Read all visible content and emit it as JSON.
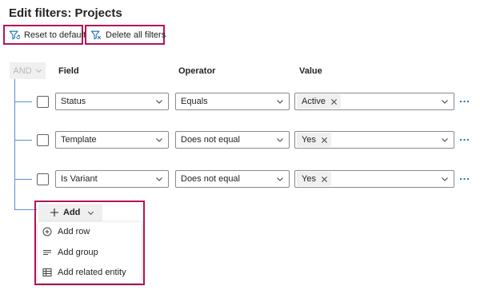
{
  "page": {
    "title": "Edit filters: Projects"
  },
  "toolbar": {
    "reset_label": "Reset to default",
    "delete_label": "Delete all filters"
  },
  "group": {
    "operator": "AND"
  },
  "columns": {
    "field": "Field",
    "operator": "Operator",
    "value": "Value"
  },
  "rows": [
    {
      "field": "Status",
      "operator": "Equals",
      "value": "Active"
    },
    {
      "field": "Template",
      "operator": "Does not equal",
      "value": "Yes"
    },
    {
      "field": "Is Variant",
      "operator": "Does not equal",
      "value": "Yes"
    }
  ],
  "add": {
    "label": "Add",
    "menu": [
      {
        "label": "Add row",
        "icon": "add-circle-icon"
      },
      {
        "label": "Add group",
        "icon": "lines-icon"
      },
      {
        "label": "Add related entity",
        "icon": "table-icon"
      }
    ]
  },
  "colors": {
    "highlight_border": "#b4145a",
    "connector": "#5b8fd6",
    "filter_icon": "#0f6cbd"
  }
}
